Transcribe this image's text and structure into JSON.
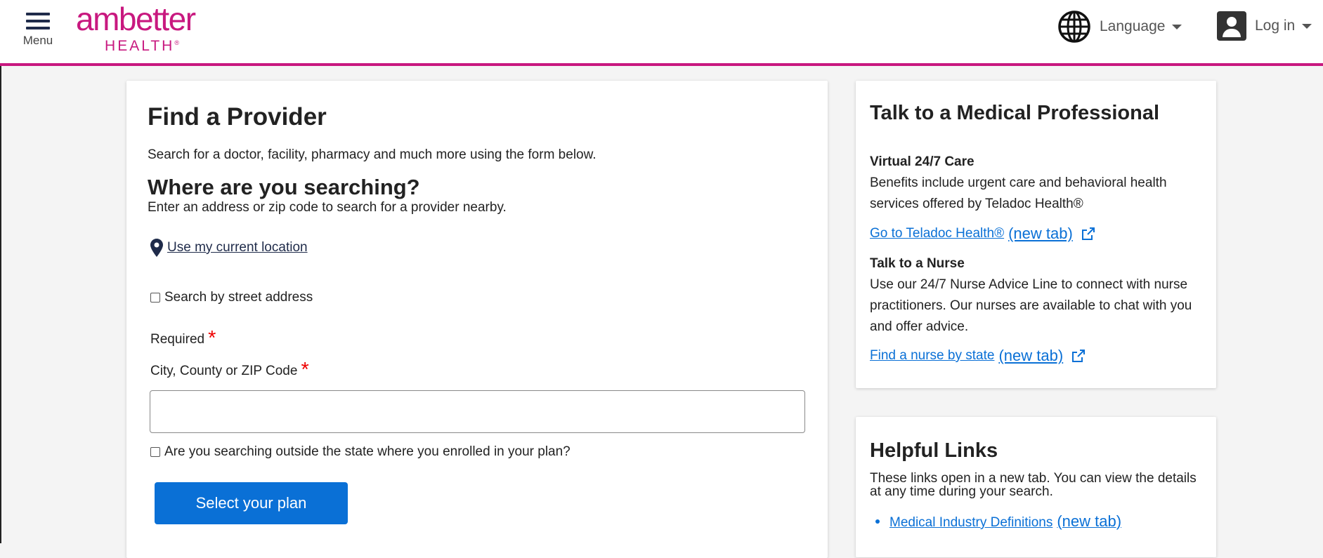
{
  "header": {
    "menu_label": "Menu",
    "logo_top": "ambetter",
    "logo_bottom": "HEALTH",
    "logo_reg": "®",
    "language_label": "Language",
    "login_label": "Log in",
    "accent_color": "#c8187f"
  },
  "main": {
    "title": "Find a Provider",
    "intro": "Search for a doctor, facility, pharmacy and much more using the form below.",
    "where_heading": "Where are you searching?",
    "where_sub": "Enter an address or zip code to search for a provider nearby.",
    "use_location_link": "Use my current location",
    "street_checkbox_label": "Search by street address",
    "required_label": "Required",
    "required_star": "*",
    "zip_label": "City, County or ZIP Code",
    "zip_value": "",
    "outside_state_label": "Are you searching outside the state where you enrolled in your plan?",
    "plan_button": "Select your plan",
    "button_color": "#0a70d6"
  },
  "sidebar": {
    "medical": {
      "title": "Talk to a Medical Professional",
      "virtual_heading": "Virtual 24/7 Care",
      "virtual_text": "Benefits include urgent care and behavioral health services offered by Teladoc Health®",
      "teladoc_link": "Go to Teladoc Health®",
      "new_tab": "(new tab)",
      "nurse_heading": "Talk to a Nurse",
      "nurse_text": "Use our 24/7 Nurse Advice Line to connect with nurse practitioners. Our nurses are available to chat with you and offer advice.",
      "nurse_link": "Find a nurse by state"
    },
    "helpful": {
      "title": "Helpful Links",
      "text": "These links open in a new tab. You can view the details at any time during your search.",
      "link1": "Medical Industry Definitions",
      "new_tab": "(new tab)"
    }
  }
}
